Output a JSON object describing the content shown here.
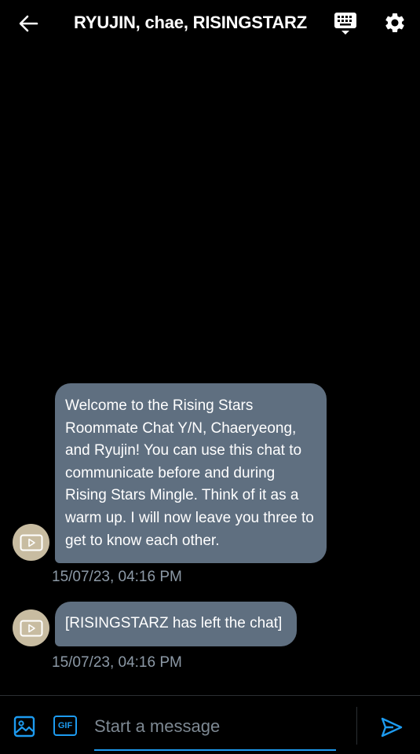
{
  "header": {
    "title": "RYUJIN, chae, RISINGSTARZ"
  },
  "messages": [
    {
      "text": "Welcome to the Rising Stars Roommate Chat Y/N, Chaeryeong, and Ryujin! You can use this chat to communicate before and during Rising Stars Mingle. Think of it as a warm up. I will now leave you three to get to know each other.",
      "timestamp": "15/07/23, 04:16 PM"
    },
    {
      "text": "[RISINGSTARZ has left the chat]",
      "timestamp": "15/07/23, 04:16 PM"
    }
  ],
  "composer": {
    "placeholder": "Start a message",
    "gif_label": "GIF"
  },
  "colors": {
    "background": "#000000",
    "bubble": "#5f6f80",
    "accent": "#1d9bf0",
    "avatar": "#c8bca1",
    "timestamp": "#8c99a6"
  }
}
